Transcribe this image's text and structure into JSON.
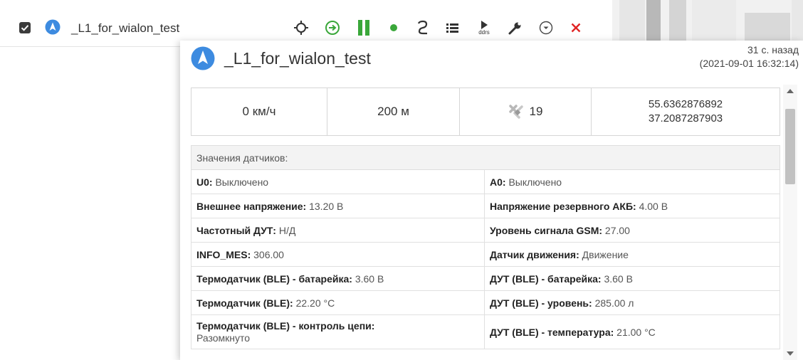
{
  "unit": {
    "name": "_L1_for_wialon_test",
    "checked": true,
    "icon": "navigation-arrow-icon"
  },
  "toolbar": {
    "icons": [
      "locate-crosshair-icon",
      "command-arrow-icon",
      "pause-icon",
      "status-dot-icon",
      "track-icon",
      "list-icon",
      "play-ddrs-icon",
      "wrench-icon",
      "chevron-circle-icon",
      "close-icon"
    ],
    "play_label": "ddrs",
    "colors": {
      "accent": "#3aa73a",
      "close": "#e02424",
      "unit_icon": "#3d8be0"
    }
  },
  "popup": {
    "title": "_L1_for_wialon_test",
    "ago": "31 с. назад",
    "datetime": "(2021-09-01 16:32:14)",
    "stats": {
      "speed": "0 км/ч",
      "altitude": "200 м",
      "satellites": "19",
      "lat": "55.6362876892",
      "lon": "37.2087287903"
    },
    "sensors_header": "Значения датчиков:",
    "sensors": [
      [
        {
          "label": "U0:",
          "value": "Выключено"
        },
        {
          "label": "A0:",
          "value": "Выключено"
        }
      ],
      [
        {
          "label": "Внешнее напряжение:",
          "value": "13.20 В"
        },
        {
          "label": "Напряжение резервного АКБ:",
          "value": "4.00 В"
        }
      ],
      [
        {
          "label": "Частотный ДУТ:",
          "value": "Н/Д"
        },
        {
          "label": "Уровень сигнала GSM:",
          "value": "27.00"
        }
      ],
      [
        {
          "label": "INFO_MES:",
          "value": "306.00"
        },
        {
          "label": "Датчик движения:",
          "value": "Движение"
        }
      ],
      [
        {
          "label": "Термодатчик (BLE) - батарейка:",
          "value": "3.60 В"
        },
        {
          "label": "ДУТ (BLE) - батарейка:",
          "value": "3.60 В"
        }
      ],
      [
        {
          "label": "Термодатчик (BLE):",
          "value": "22.20 °С"
        },
        {
          "label": "ДУТ (BLE) - уровень:",
          "value": "285.00 л"
        }
      ],
      [
        {
          "label": "Термодатчик (BLE) - контроль цепи:",
          "value": "Разомкнуто"
        },
        {
          "label": "ДУТ (BLE) - температура:",
          "value": "21.00 °С"
        }
      ]
    ]
  }
}
